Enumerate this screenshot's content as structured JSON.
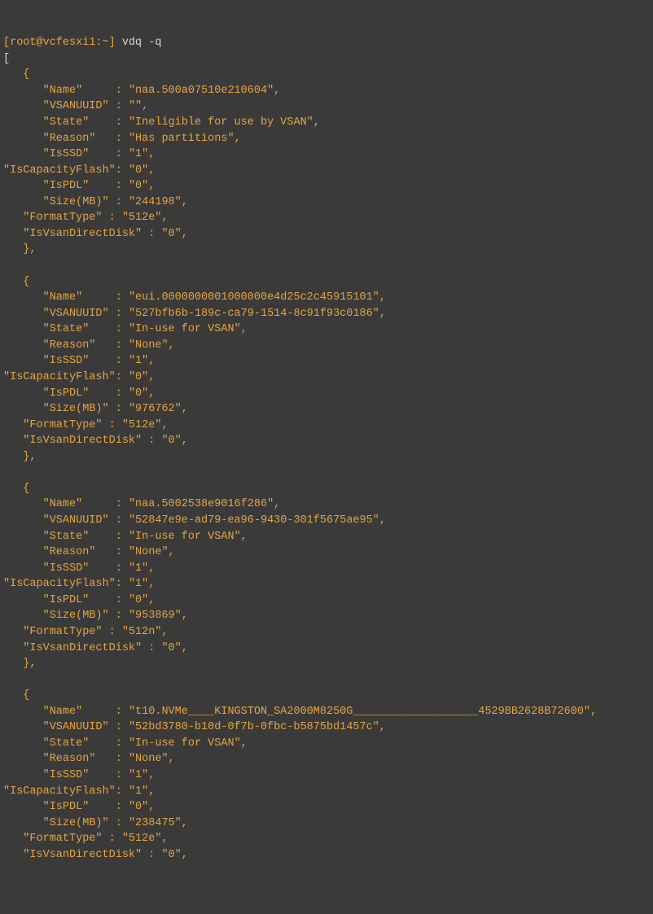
{
  "prompt": {
    "userhost": "[root@vcfesxi1:~]",
    "command": "vdq -q"
  },
  "open_bracket": "[",
  "entry_open": "   {",
  "entry_close": "   },",
  "blank": "",
  "labels": {
    "name": "      \"Name\"     : ",
    "vsanuuid": "      \"VSANUUID\" : ",
    "state": "      \"State\"    : ",
    "reason": "      \"Reason\"   : ",
    "isssd": "      \"IsSSD\"    : ",
    "iscapflash": "\"IsCapacityFlash\": ",
    "ispdl": "      \"IsPDL\"    : ",
    "sizemb": "      \"Size(MB)\" : ",
    "formattype": "   \"FormatType\" : ",
    "isvsandirect": "   \"IsVsanDirectDisk\" : "
  },
  "entries": [
    {
      "Name": "\"naa.500a07510e210604\",",
      "VSANUUID": "\"\",",
      "State": "\"Ineligible for use by VSAN\",",
      "Reason": "\"Has partitions\",",
      "IsSSD": "\"1\",",
      "IsCapacityFlash": "\"0\",",
      "IsPDL": "\"0\",",
      "SizeMB": "\"244198\",",
      "FormatType": "\"512e\",",
      "IsVsanDirectDisk": "\"0\","
    },
    {
      "Name": "\"eui.0000000001000000e4d25c2c45915101\",",
      "VSANUUID": "\"527bfb6b-189c-ca79-1514-8c91f93c0186\",",
      "State": "\"In-use for VSAN\",",
      "Reason": "\"None\",",
      "IsSSD": "\"1\",",
      "IsCapacityFlash": "\"0\",",
      "IsPDL": "\"0\",",
      "SizeMB": "\"976762\",",
      "FormatType": "\"512e\",",
      "IsVsanDirectDisk": "\"0\","
    },
    {
      "Name": "\"naa.5002538e9016f286\",",
      "VSANUUID": "\"52847e9e-ad79-ea96-9430-301f5675ae95\",",
      "State": "\"In-use for VSAN\",",
      "Reason": "\"None\",",
      "IsSSD": "\"1\",",
      "IsCapacityFlash": "\"1\",",
      "IsPDL": "\"0\",",
      "SizeMB": "\"953869\",",
      "FormatType": "\"512n\",",
      "IsVsanDirectDisk": "\"0\","
    },
    {
      "Name": "\"t10.NVMe____KINGSTON_SA2000M8250G___________________4529BB2628B72600\",",
      "VSANUUID": "\"52bd3780-b10d-0f7b-0fbc-b5875bd1457c\",",
      "State": "\"In-use for VSAN\",",
      "Reason": "\"None\",",
      "IsSSD": "\"1\",",
      "IsCapacityFlash": "\"1\",",
      "IsPDL": "\"0\",",
      "SizeMB": "\"238475\",",
      "FormatType": "\"512e\",",
      "IsVsanDirectDisk": "\"0\","
    }
  ]
}
